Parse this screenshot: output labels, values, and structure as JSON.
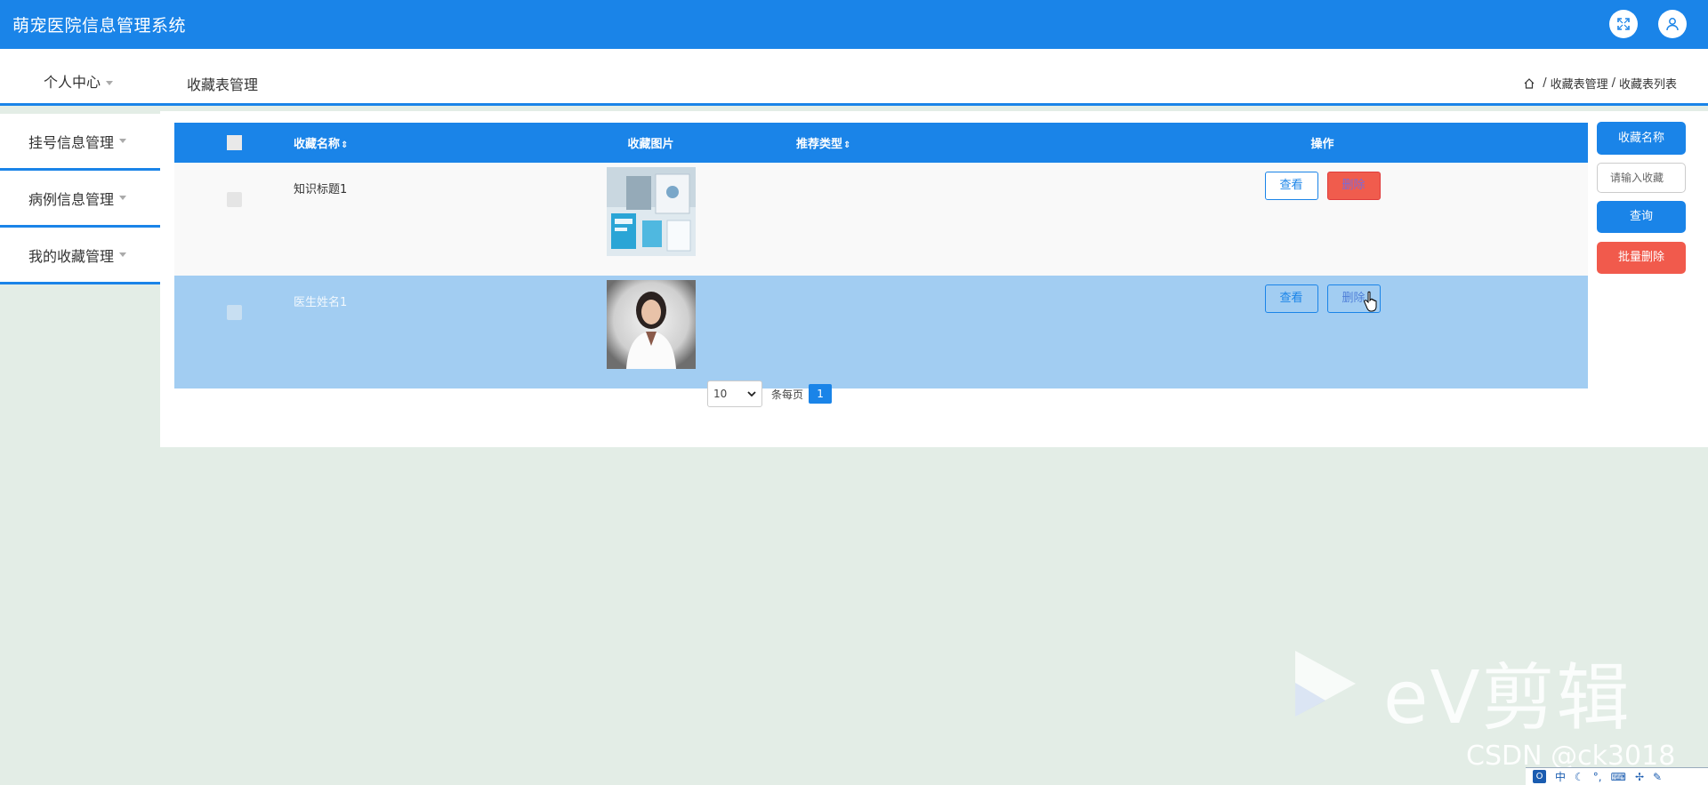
{
  "app": {
    "title": "萌宠医院信息管理系统"
  },
  "header": {
    "menu_label": "个人中心",
    "page_title": "收藏表管理",
    "breadcrumb": [
      "收藏表管理",
      "收藏表列表"
    ],
    "breadcrumb_sep": "/"
  },
  "sidebar": {
    "items": [
      {
        "label": "挂号信息管理"
      },
      {
        "label": "病例信息管理"
      },
      {
        "label": "我的收藏管理"
      }
    ]
  },
  "table": {
    "columns": [
      {
        "label": "收藏名称",
        "sortable": true
      },
      {
        "label": "收藏图片",
        "sortable": false
      },
      {
        "label": "推荐类型",
        "sortable": true
      },
      {
        "label": "操作",
        "sortable": false
      }
    ],
    "sort_glyph": "⇕",
    "rows": [
      {
        "name": "知识标题1",
        "image": "office-desk-photo",
        "type": "",
        "view_label": "查看",
        "delete_label": "删除"
      },
      {
        "name": "医生姓名1",
        "image": "doctor-portrait-photo",
        "type": "",
        "view_label": "查看",
        "delete_label": "删除"
      }
    ]
  },
  "pagination": {
    "page_size": "10",
    "per_page_label": "条每页",
    "current_page": "1"
  },
  "search_panel": {
    "label": "收藏名称",
    "placeholder": "请输入收藏",
    "query_button": "查询",
    "batch_delete_button": "批量删除"
  },
  "watermark": {
    "ev_text": "eV剪辑",
    "csdn_text": "CSDN @ck3018"
  },
  "tray": {
    "o_label": "O",
    "ime_label": "中"
  },
  "colors": {
    "primary": "#1a84e8",
    "danger": "#f15a4c",
    "selected_row": "#a2cdf2"
  }
}
